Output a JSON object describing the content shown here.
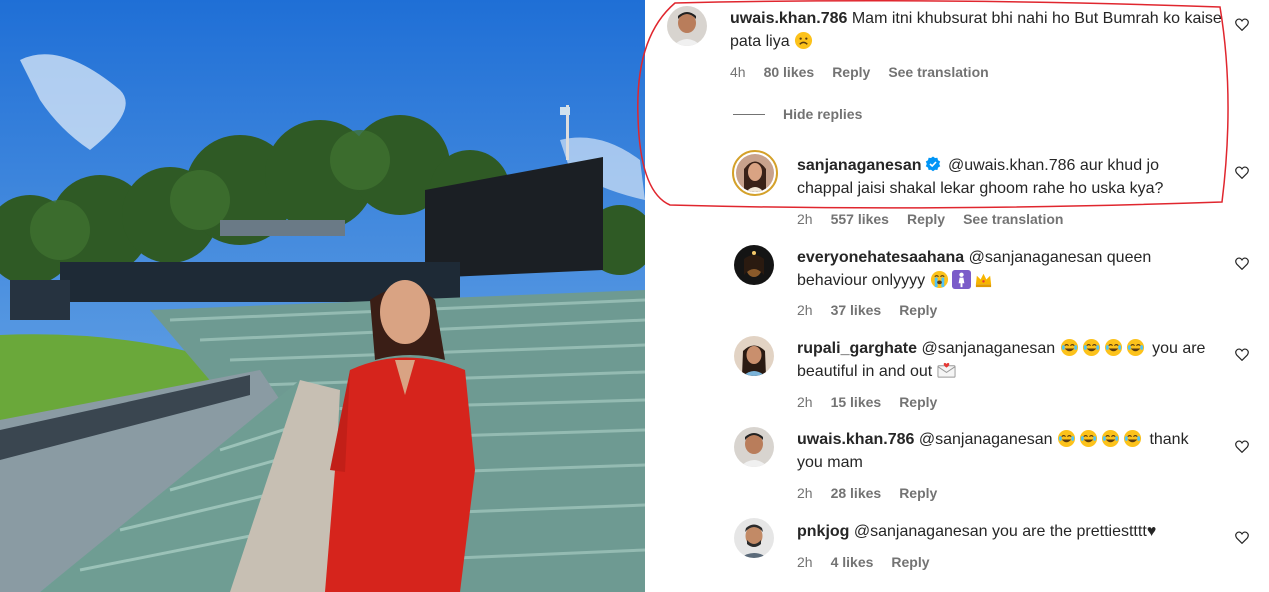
{
  "comments": [
    {
      "username": "uwais.khan.786",
      "text": "Mam itni khubsurat bhi nahi ho But Bumrah ko kaise pata liya",
      "time": "4h",
      "likes": "80 likes",
      "reply": "Reply",
      "translate": "See translation",
      "emoji": [
        "sad-face"
      ]
    },
    {
      "username": "sanjanaganesan",
      "verified": true,
      "text": "@uwais.khan.786 aur khud jo chappal jaisi shakal lekar ghoom rahe ho uska kya?",
      "time": "2h",
      "likes": "557 likes",
      "reply": "Reply",
      "translate": "See translation"
    },
    {
      "username": "everyonehatesaahana",
      "text": "@sanjanaganesan queen behaviour onlyyyy",
      "time": "2h",
      "likes": "37 likes",
      "reply": "Reply",
      "emoji": [
        "crying-face",
        "woman-standing",
        "crown"
      ]
    },
    {
      "username": "rupali_garghate",
      "text": "@sanjanaganesan",
      "text2": "you are beautiful in and out",
      "time": "2h",
      "likes": "15 likes",
      "reply": "Reply",
      "emoji": [
        "joy",
        "joy",
        "joy",
        "joy",
        "love-letter"
      ]
    },
    {
      "username": "uwais.khan.786",
      "text": "@sanjanaganesan",
      "text2": "thank you mam",
      "time": "2h",
      "likes": "28 likes",
      "reply": "Reply",
      "emoji": [
        "joy",
        "joy",
        "joy",
        "joy"
      ]
    },
    {
      "username": "pnkjog",
      "text": "@sanjanaganesan you are the prettiestttt♥",
      "time": "2h",
      "likes": "4 likes",
      "reply": "Reply"
    }
  ],
  "hide_replies": "Hide replies",
  "colors": {
    "highlight": "#e0262e",
    "verified": "#0095f6",
    "muted": "#737373"
  },
  "icons": {
    "like": "heart-outline-icon",
    "verified": "verified-badge-icon"
  }
}
